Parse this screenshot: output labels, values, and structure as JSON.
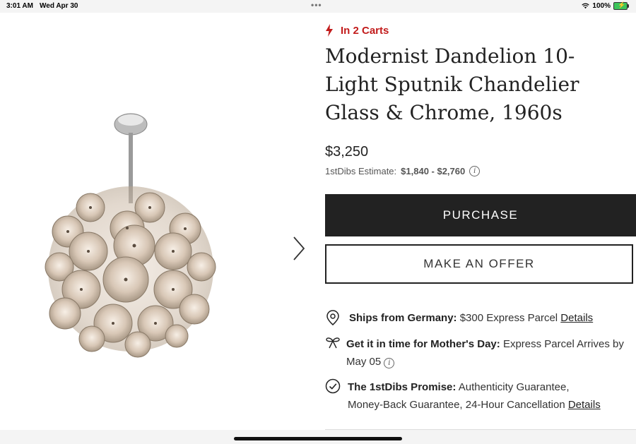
{
  "status": {
    "time": "3:01 AM",
    "date": "Wed Apr 30",
    "dots": "•••",
    "battery": "100%"
  },
  "product": {
    "carts_label": "In 2 Carts",
    "title": "Modernist Dandelion 10-Light Sputnik Chandelier Glass & Chrome, 1960s",
    "price": "$3,250",
    "estimate_label": "1stDibs Estimate:",
    "estimate_value": "$1,840 - $2,760"
  },
  "actions": {
    "purchase": "PURCHASE",
    "offer": "MAKE AN OFFER"
  },
  "shipping": {
    "ships_bold": "Ships from Germany:",
    "ships_text": "$300 Express Parcel",
    "ships_link": "Details",
    "gift_bold": "Get it in time for Mother's Day:",
    "gift_text": "Express Parcel Arrives by",
    "gift_date": "May 05",
    "promise_bold": "The 1stDibs Promise:",
    "promise_text1": "Authenticity Guarantee,",
    "promise_text2": "Money-Back Guarantee, 24-Hour Cancellation",
    "promise_link": "Details"
  },
  "colors": {
    "accent_red": "#c21c1c",
    "button_dark": "#222222"
  },
  "icons": [
    "lightning-icon",
    "chevron-right-icon",
    "location-pin-icon",
    "gift-bow-icon",
    "check-circle-icon",
    "info-icon",
    "wifi-icon",
    "battery-icon"
  ]
}
